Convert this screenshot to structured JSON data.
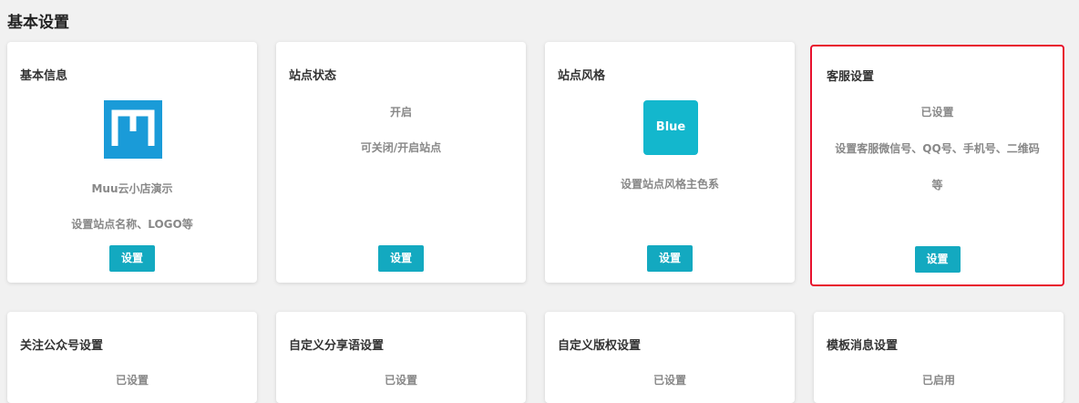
{
  "page": {
    "title": "基本设置"
  },
  "colors": {
    "button": "#13a9c0",
    "highlight_border": "#e8112d",
    "logo_m": "#1a9bd8",
    "logo_blue": "#13b7cd"
  },
  "cards": [
    {
      "title": "基本信息",
      "logo_icon": "muu-logo-icon",
      "name": "Muu云小店演示",
      "desc": "设置站点名称、LOGO等",
      "button": "设置"
    },
    {
      "title": "站点状态",
      "status": "开启",
      "desc": "可关闭/开启站点",
      "button": "设置"
    },
    {
      "title": "站点风格",
      "logo_text": "Blue",
      "desc": "设置站点风格主色系",
      "button": "设置"
    },
    {
      "title": "客服设置",
      "status": "已设置",
      "desc_line1": "设置客服微信号、QQ号、手机号、二维码",
      "desc_line2": "等",
      "button": "设置"
    },
    {
      "title": "关注公众号设置",
      "status": "已设置"
    },
    {
      "title": "自定义分享语设置",
      "status": "已设置"
    },
    {
      "title": "自定义版权设置",
      "status": "已设置"
    },
    {
      "title": "模板消息设置",
      "status": "已启用"
    }
  ]
}
